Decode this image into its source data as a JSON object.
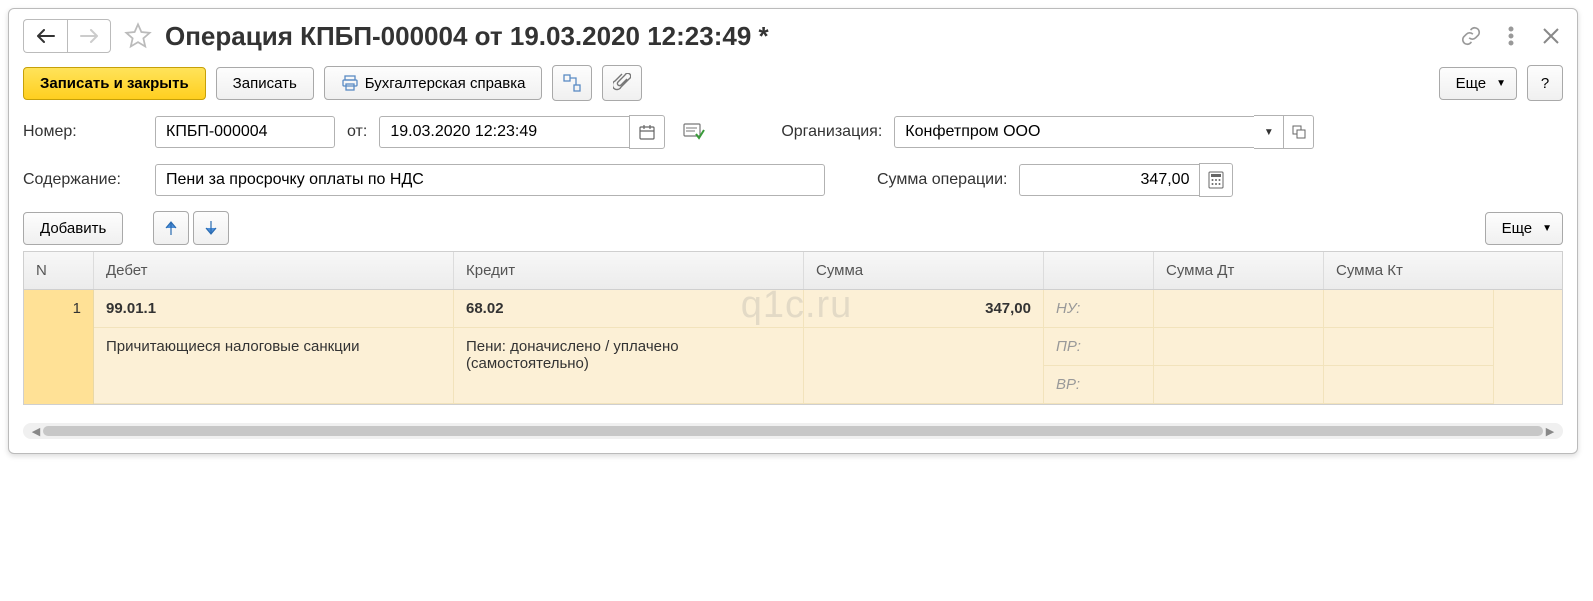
{
  "title": "Операция КПБП-000004 от 19.03.2020 12:23:49 *",
  "toolbar": {
    "save_close": "Записать и закрыть",
    "save": "Записать",
    "report": "Бухгалтерская справка",
    "more": "Еще",
    "help": "?"
  },
  "form": {
    "number_label": "Номер:",
    "number": "КПБП-000004",
    "from_label": "от:",
    "date": "19.03.2020 12:23:49",
    "org_label": "Организация:",
    "org": "Конфетпром ООО",
    "content_label": "Содержание:",
    "content": "Пени за просрочку оплаты по НДС",
    "sum_label": "Сумма операции:",
    "sum": "347,00"
  },
  "table_toolbar": {
    "add": "Добавить",
    "more": "Еще"
  },
  "columns": {
    "n": "N",
    "debit": "Дебет",
    "credit": "Кредит",
    "sum": "Сумма",
    "sum_blank": "",
    "sum_dt": "Сумма Дт",
    "sum_kt": "Сумма Кт"
  },
  "rows": [
    {
      "n": "1",
      "debit_acc": "99.01.1",
      "debit_desc": "Причитающиеся налоговые санкции",
      "credit_acc": "68.02",
      "credit_desc": "Пени: доначислено / уплачено (самостоятельно)",
      "sum": "347,00",
      "tags": [
        "НУ:",
        "ПР:",
        "ВР:"
      ]
    }
  ],
  "watermark": "q1c.ru"
}
